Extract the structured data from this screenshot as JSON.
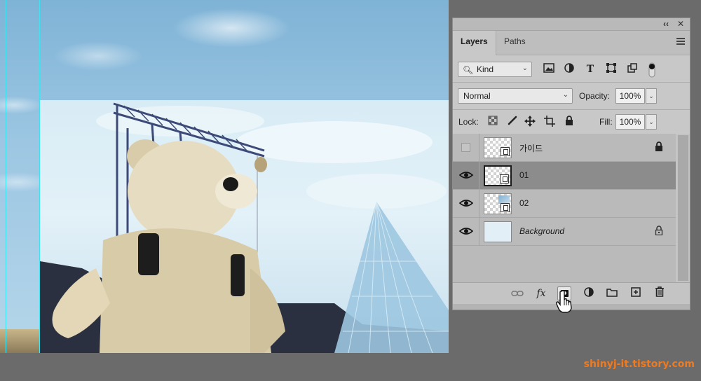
{
  "panel": {
    "tabs": [
      {
        "label": "Layers",
        "active": true
      },
      {
        "label": "Paths",
        "active": false
      }
    ],
    "topbar": {
      "collapse_glyph": "‹‹",
      "close_glyph": "✕"
    },
    "filter": {
      "kind_label": "Kind",
      "icons": [
        "image-filter-icon",
        "adjustment-filter-icon",
        "type-filter-icon",
        "shape-filter-icon",
        "smart-object-filter-icon",
        "filter-toggle-icon"
      ]
    },
    "blend": {
      "mode": "Normal",
      "opacity_label": "Opacity:",
      "opacity_value": "100%"
    },
    "lock": {
      "label": "Lock:",
      "fill_label": "Fill:",
      "fill_value": "100%"
    },
    "layers": [
      {
        "name": "가이드",
        "visible": false,
        "selected": false,
        "locked": true,
        "italic": false,
        "type": "smart-object"
      },
      {
        "name": "01",
        "visible": true,
        "selected": true,
        "locked": false,
        "italic": false,
        "type": "smart-object"
      },
      {
        "name": "02",
        "visible": true,
        "selected": false,
        "locked": false,
        "italic": false,
        "type": "smart-object"
      },
      {
        "name": "Background",
        "visible": true,
        "selected": false,
        "locked": true,
        "italic": true,
        "type": "background"
      }
    ],
    "bottom_toolbar": [
      "link-layers-icon",
      "fx-icon",
      "add-mask-icon",
      "adjustment-layer-icon",
      "new-group-icon",
      "new-layer-icon",
      "delete-layer-icon"
    ],
    "fx_label": "fx"
  },
  "watermark": "shinyj-it.tistory.com",
  "colors": {
    "workspace": "#6b6b6b",
    "panel": "#c8c8c8",
    "selected_row": "#8c8c8c",
    "guide": "#3fe3f0",
    "watermark": "#f07a1e"
  }
}
